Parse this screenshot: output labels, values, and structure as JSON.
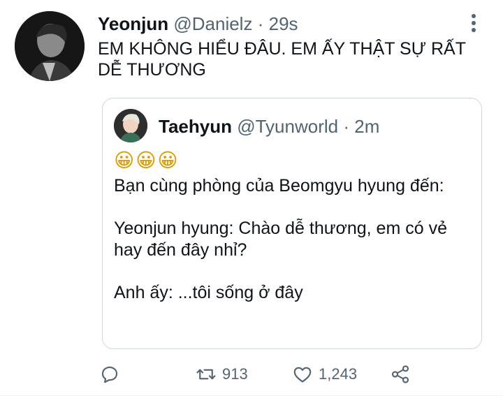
{
  "tweet": {
    "author_name": "Yeonjun",
    "handle": "@Danielz",
    "separator": "·",
    "time": "29s",
    "text": "EM KHÔNG HIỂU ĐÂU. EM ẤY THẬT SỰ RẤT DỄ THƯƠNG"
  },
  "quoted": {
    "author_name": "Taehyun",
    "handle": "@Tyunworld",
    "separator": "·",
    "time": "2m",
    "emoji": "😀😀😀",
    "paragraphs": [
      "Bạn cùng phòng của Beomgyu hyung đến:",
      "Yeonjun hyung: Chào dễ thương, em có vẻ hay đến đây nhỉ?",
      "Anh ấy: ...tôi sống ở đây"
    ]
  },
  "actions": {
    "retweets": "913",
    "likes": "1,243"
  },
  "colors": {
    "text": "#0f1419",
    "secondary": "#536471",
    "border": "#cfd9de"
  },
  "icons": [
    "more-icon",
    "reply-icon",
    "retweet-icon",
    "like-icon",
    "share-icon"
  ]
}
